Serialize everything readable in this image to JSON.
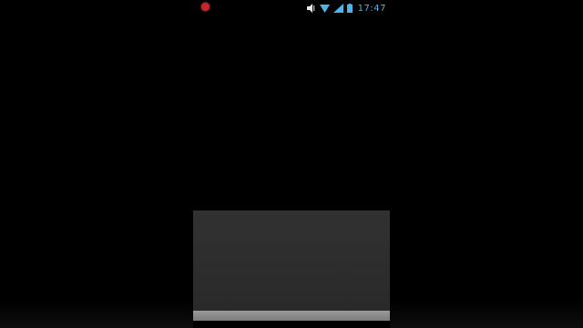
{
  "status_bar": {
    "time": "17:47",
    "icons": [
      "notification-dot-icon",
      "volume-icon",
      "wifi-icon",
      "signal-icon",
      "battery-icon"
    ],
    "accent_color": "#4fb3e6",
    "notification_color": "#c4282b"
  },
  "sheet": {
    "background_color": "#2e2e2e",
    "bar_color": "#8c8c8c"
  }
}
